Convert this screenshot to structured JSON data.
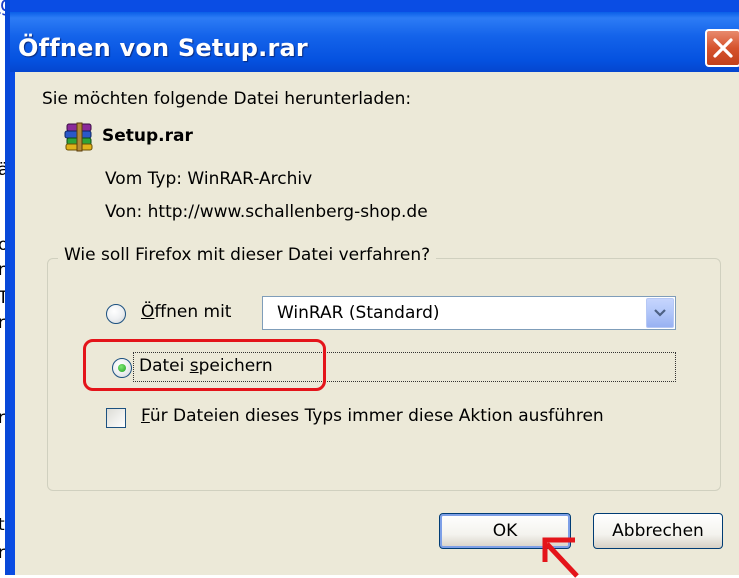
{
  "background_page": {
    "link_fragment": "g.",
    "text_fragments": [
      "ä",
      "o",
      "n",
      "T",
      "r",
      "r",
      "t",
      "r"
    ]
  },
  "dialog": {
    "title": "Öffnen von Setup.rar",
    "intro": "Sie möchten folgende Datei herunterladen:",
    "file": {
      "icon": "winrar-archive-icon",
      "name": "Setup.rar",
      "type_label": "Vom Typ:",
      "type_value": "WinRAR-Archiv",
      "from_label": "Von:",
      "from_value": "http://www.schallenberg-shop.de"
    },
    "action_group": {
      "legend": "Wie soll Firefox mit dieser Datei verfahren?",
      "open_with": {
        "accel": "Ö",
        "rest": "ffnen mit",
        "selected": false
      },
      "open_with_app": {
        "value": "WinRAR (Standard)"
      },
      "save_file": {
        "label_pre": "Datei ",
        "accel": "s",
        "label_post": "peichern",
        "selected": true
      },
      "always_do": {
        "accel": "F",
        "rest": "ür Dateien dieses Typs immer diese Aktion ausführen",
        "checked": false
      }
    },
    "buttons": {
      "ok": "OK",
      "cancel": "Abbrechen"
    }
  },
  "colors": {
    "title_bar": "#0a5fe8",
    "client_bg": "#ece9d8",
    "highlight_outline": "#e4141a",
    "close_button": "#d6532d"
  }
}
